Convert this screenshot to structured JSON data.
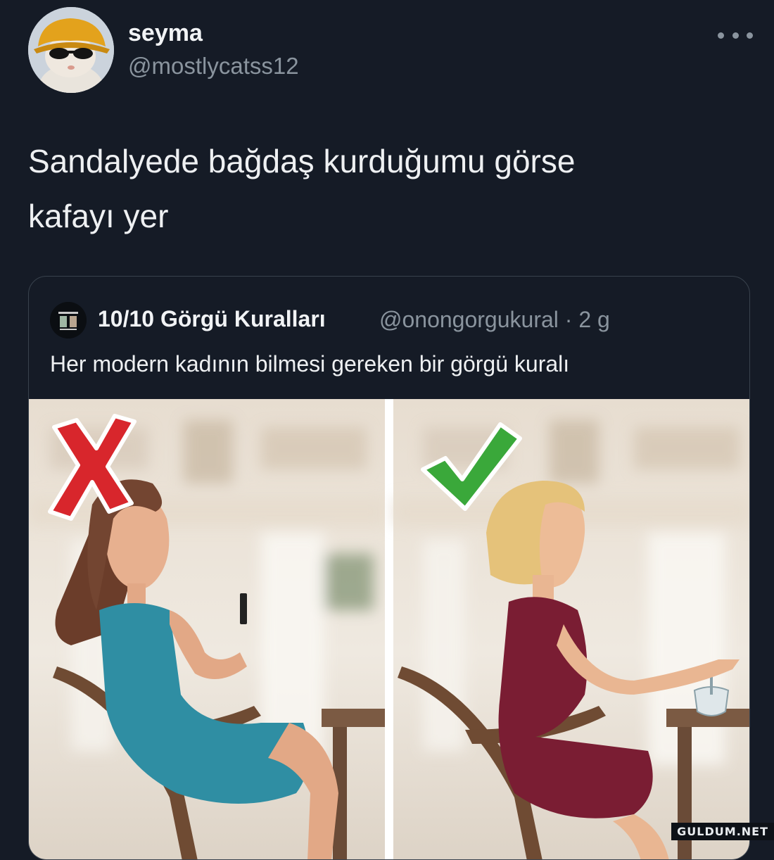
{
  "tweet": {
    "author": {
      "display_name": "seyma",
      "handle": "@mostlycatss12",
      "avatar_icon": "profile-avatar"
    },
    "more_icon": "more-dots-icon",
    "text_line1": "Sandalyede bağdaş kurduğumu görse",
    "text_line2": "kafayı yer"
  },
  "quoted_tweet": {
    "display_name": "10/10 Görgü Kuralları",
    "meta": "@onongorgukural · 2 g",
    "text": "Her modern kadının bilmesi gereken bir görgü kuralı",
    "media": {
      "left_mark_icon": "red-x-icon",
      "right_mark_icon": "green-check-icon"
    }
  },
  "watermark": "GULDUM.NET",
  "colors": {
    "background": "#151b26",
    "red_mark": "#d8262c",
    "green_mark": "#3aa83a",
    "blue_dress": "#2f8ea3",
    "red_dress": "#7a1d33"
  }
}
